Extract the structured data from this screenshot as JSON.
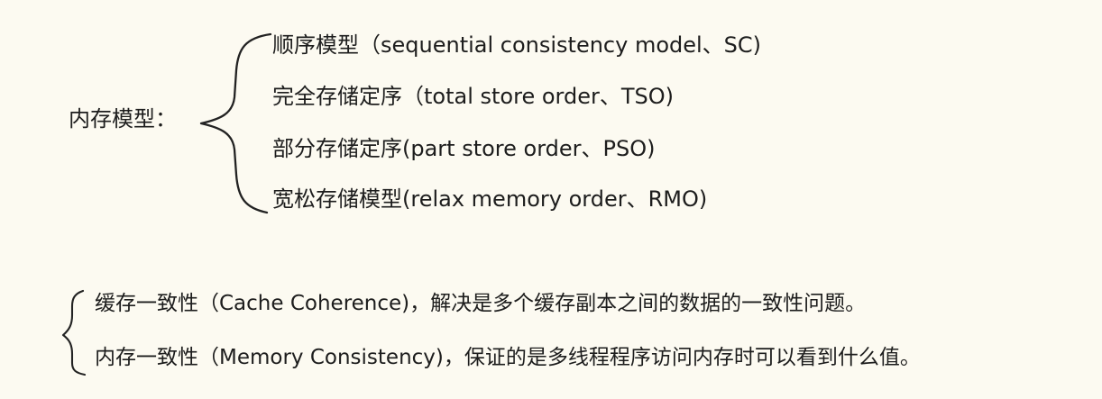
{
  "title": "内存模型：",
  "items": [
    "顺序模型（sequential consistency model、SC)",
    "完全存储定序（total store order、TSO)",
    "部分存储定序(part store order、PSO)",
    "宽松存储模型(relax memory order、RMO)"
  ],
  "consistency_notes": [
    "缓存一致性（Cache Coherence)，解决是多个缓存副本之间的数据的一致性问题。",
    "内存一致性（Memory Consistency)，保证的是多线程程序访问内存时可以看到什么值。"
  ]
}
